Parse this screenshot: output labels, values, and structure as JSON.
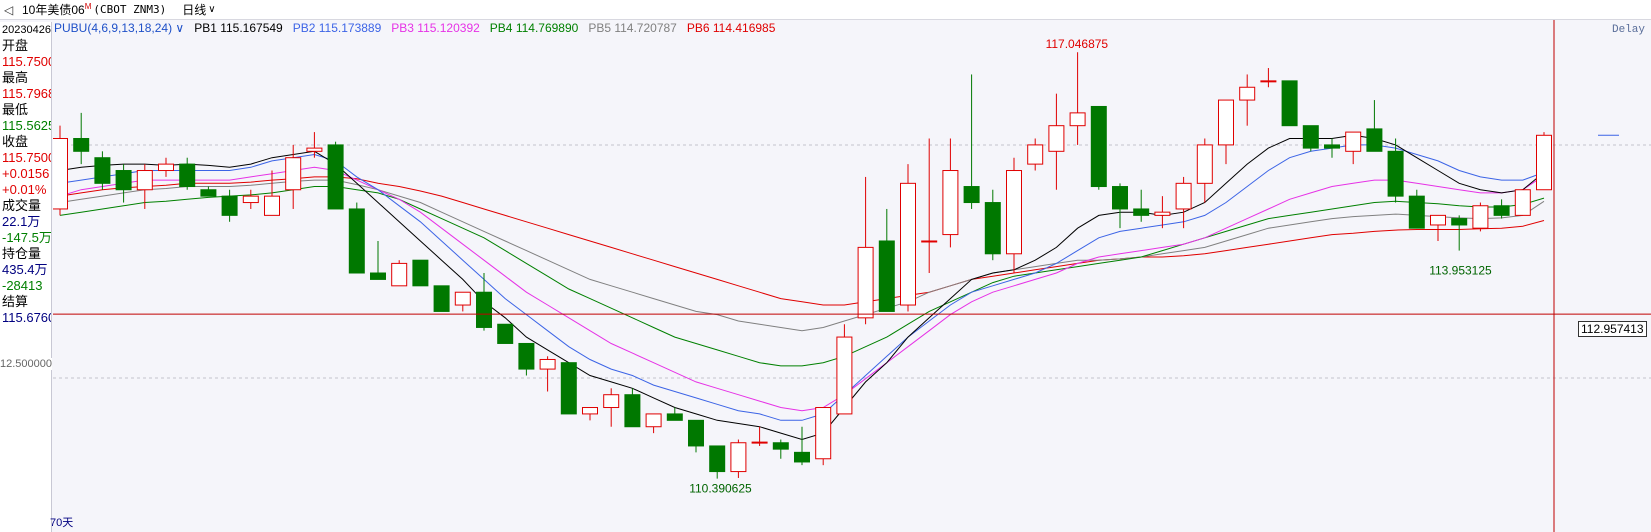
{
  "titlebar": {
    "instrument": "10年美债06",
    "instrument_sup": "M",
    "code": "(CBOT ZNM3)",
    "period": "日线",
    "back_icon": "back-icon",
    "dropdown_icon": "chevron-down-icon"
  },
  "info": {
    "date": "20230426",
    "open_label": "开盘",
    "open": "115.7500",
    "high_label": "最高",
    "high": "115.7968",
    "low_label": "最低",
    "low": "115.5625",
    "close_label": "收盘",
    "close": "115.7500",
    "change": "+0.0156",
    "change_pct": "+0.01%",
    "volume_label": "成交量",
    "volume": "22.1万",
    "volume_change": "-147.5万",
    "oi_label": "持仓量",
    "oi": "435.4万",
    "oi_change": "-28413",
    "settle_label": "结算",
    "settle": "115.6760"
  },
  "legend": {
    "pubu": "PUBU(4,6,9,13,18,24)",
    "pb1": "PB1 115.167549",
    "pb2": "PB2 115.173889",
    "pb3": "PB3 115.120392",
    "pb4": "PB4 114.769890",
    "pb5": "PB5 114.720787",
    "pb6": "PB6 114.416985"
  },
  "delay": "Delay",
  "period_label": "70天",
  "grid_level_label": "12.500000",
  "crosshair_price": "112.957413",
  "colors": {
    "up": "#e00000",
    "down": "#007800",
    "pb1": "#000000",
    "pb2": "#3c64e6",
    "pb3": "#e632e6",
    "pb4": "#008000",
    "pb5": "#808080",
    "pb6": "#e00000"
  },
  "chart_data": {
    "type": "candlestick",
    "ylim": [
      109.9,
      117.55
    ],
    "annotations": {
      "max": "117.046875",
      "min": "110.390625",
      "local_low": "113.953125"
    },
    "candles": [
      {
        "o": 114.6,
        "h": 115.9,
        "l": 114.5,
        "c": 115.7
      },
      {
        "o": 115.7,
        "h": 116.1,
        "l": 115.3,
        "c": 115.5
      },
      {
        "o": 115.4,
        "h": 115.5,
        "l": 114.9,
        "c": 115.0
      },
      {
        "o": 115.2,
        "h": 115.3,
        "l": 114.7,
        "c": 114.9
      },
      {
        "o": 114.9,
        "h": 115.3,
        "l": 114.6,
        "c": 115.2
      },
      {
        "o": 115.2,
        "h": 115.4,
        "l": 115.1,
        "c": 115.3
      },
      {
        "o": 115.3,
        "h": 115.4,
        "l": 114.9,
        "c": 114.95
      },
      {
        "o": 114.9,
        "h": 114.95,
        "l": 114.8,
        "c": 114.8
      },
      {
        "o": 114.8,
        "h": 114.9,
        "l": 114.4,
        "c": 114.5
      },
      {
        "o": 114.7,
        "h": 114.9,
        "l": 114.6,
        "c": 114.8
      },
      {
        "o": 114.5,
        "h": 115.2,
        "l": 114.5,
        "c": 114.8
      },
      {
        "o": 114.9,
        "h": 115.6,
        "l": 114.6,
        "c": 115.4
      },
      {
        "o": 115.5,
        "h": 115.8,
        "l": 115.4,
        "c": 115.55
      },
      {
        "o": 115.6,
        "h": 115.65,
        "l": 114.6,
        "c": 114.6
      },
      {
        "o": 114.6,
        "h": 114.7,
        "l": 113.6,
        "c": 113.6
      },
      {
        "o": 113.6,
        "h": 114.1,
        "l": 113.5,
        "c": 113.5
      },
      {
        "o": 113.4,
        "h": 113.8,
        "l": 113.4,
        "c": 113.75
      },
      {
        "o": 113.8,
        "h": 113.8,
        "l": 113.4,
        "c": 113.4
      },
      {
        "o": 113.4,
        "h": 113.4,
        "l": 113.0,
        "c": 113.0
      },
      {
        "o": 113.1,
        "h": 113.3,
        "l": 113.0,
        "c": 113.3
      },
      {
        "o": 113.3,
        "h": 113.6,
        "l": 112.7,
        "c": 112.75
      },
      {
        "o": 112.8,
        "h": 112.8,
        "l": 112.5,
        "c": 112.5
      },
      {
        "o": 112.5,
        "h": 112.5,
        "l": 112.0,
        "c": 112.1
      },
      {
        "o": 112.1,
        "h": 112.3,
        "l": 111.75,
        "c": 112.25
      },
      {
        "o": 112.2,
        "h": 112.2,
        "l": 111.4,
        "c": 111.4
      },
      {
        "o": 111.4,
        "h": 111.5,
        "l": 111.3,
        "c": 111.5
      },
      {
        "o": 111.5,
        "h": 111.8,
        "l": 111.2,
        "c": 111.7
      },
      {
        "o": 111.7,
        "h": 111.8,
        "l": 111.2,
        "c": 111.2
      },
      {
        "o": 111.2,
        "h": 111.4,
        "l": 111.1,
        "c": 111.4
      },
      {
        "o": 111.4,
        "h": 111.5,
        "l": 111.3,
        "c": 111.3
      },
      {
        "o": 111.3,
        "h": 111.3,
        "l": 110.8,
        "c": 110.9
      },
      {
        "o": 110.9,
        "h": 110.9,
        "l": 110.39,
        "c": 110.5
      },
      {
        "o": 110.5,
        "h": 111.0,
        "l": 110.4,
        "c": 110.95
      },
      {
        "o": 110.95,
        "h": 111.2,
        "l": 110.9,
        "c": 110.96
      },
      {
        "o": 110.95,
        "h": 111.0,
        "l": 110.7,
        "c": 110.85
      },
      {
        "o": 110.8,
        "h": 111.2,
        "l": 110.6,
        "c": 110.65
      },
      {
        "o": 110.7,
        "h": 111.5,
        "l": 110.6,
        "c": 111.5
      },
      {
        "o": 111.4,
        "h": 112.8,
        "l": 111.4,
        "c": 112.6
      },
      {
        "o": 112.9,
        "h": 115.1,
        "l": 112.8,
        "c": 114.0
      },
      {
        "o": 114.1,
        "h": 114.6,
        "l": 113.0,
        "c": 113.0
      },
      {
        "o": 113.1,
        "h": 115.3,
        "l": 113.0,
        "c": 115.0
      },
      {
        "o": 114.1,
        "h": 115.7,
        "l": 113.6,
        "c": 114.1
      },
      {
        "o": 114.2,
        "h": 115.7,
        "l": 114.0,
        "c": 115.2
      },
      {
        "o": 114.95,
        "h": 116.7,
        "l": 114.6,
        "c": 114.7
      },
      {
        "o": 114.7,
        "h": 114.9,
        "l": 113.8,
        "c": 113.9
      },
      {
        "o": 113.9,
        "h": 115.4,
        "l": 113.6,
        "c": 115.2
      },
      {
        "o": 115.3,
        "h": 115.7,
        "l": 115.2,
        "c": 115.6
      },
      {
        "o": 115.5,
        "h": 116.4,
        "l": 114.9,
        "c": 115.9
      },
      {
        "o": 115.9,
        "h": 117.046875,
        "l": 115.6,
        "c": 116.1
      },
      {
        "o": 116.2,
        "h": 116.2,
        "l": 114.9,
        "c": 114.95
      },
      {
        "o": 114.95,
        "h": 115.0,
        "l": 114.3,
        "c": 114.6
      },
      {
        "o": 114.6,
        "h": 114.9,
        "l": 114.4,
        "c": 114.5
      },
      {
        "o": 114.5,
        "h": 114.8,
        "l": 114.3,
        "c": 114.55
      },
      {
        "o": 114.6,
        "h": 115.1,
        "l": 114.3,
        "c": 115.0
      },
      {
        "o": 115.0,
        "h": 115.7,
        "l": 114.7,
        "c": 115.6
      },
      {
        "o": 115.6,
        "h": 116.3,
        "l": 115.3,
        "c": 116.3
      },
      {
        "o": 116.3,
        "h": 116.7,
        "l": 115.9,
        "c": 116.5
      },
      {
        "o": 116.6,
        "h": 116.8,
        "l": 116.5,
        "c": 116.6
      },
      {
        "o": 116.6,
        "h": 116.6,
        "l": 115.9,
        "c": 115.9
      },
      {
        "o": 115.9,
        "h": 115.9,
        "l": 115.5,
        "c": 115.55
      },
      {
        "o": 115.6,
        "h": 115.7,
        "l": 115.4,
        "c": 115.55
      },
      {
        "o": 115.5,
        "h": 115.8,
        "l": 115.3,
        "c": 115.8
      },
      {
        "o": 115.85,
        "h": 116.3,
        "l": 115.6,
        "c": 115.5
      },
      {
        "o": 115.5,
        "h": 115.7,
        "l": 114.7,
        "c": 114.8
      },
      {
        "o": 114.8,
        "h": 114.9,
        "l": 114.3,
        "c": 114.3
      },
      {
        "o": 114.35,
        "h": 114.4,
        "l": 114.1,
        "c": 114.5
      },
      {
        "o": 114.45,
        "h": 114.5,
        "l": 113.95,
        "c": 114.35
      },
      {
        "o": 114.3,
        "h": 114.7,
        "l": 114.25,
        "c": 114.65
      },
      {
        "o": 114.65,
        "h": 114.75,
        "l": 114.45,
        "c": 114.5
      },
      {
        "o": 114.5,
        "h": 114.9,
        "l": 114.5,
        "c": 114.9
      },
      {
        "o": 114.9,
        "h": 115.8,
        "l": 114.9,
        "c": 115.75
      }
    ],
    "series": [
      {
        "name": "PB1",
        "values": [
          115.2,
          115.25,
          115.28,
          115.3,
          115.3,
          115.28,
          115.3,
          115.28,
          115.25,
          115.3,
          115.4,
          115.45,
          115.5,
          115.3,
          115.0,
          114.7,
          114.4,
          114.1,
          113.8,
          113.5,
          113.15,
          112.9,
          112.6,
          112.4,
          112.2,
          112.0,
          111.9,
          111.8,
          111.65,
          111.5,
          111.4,
          111.3,
          111.25,
          111.2,
          111.1,
          111.0,
          111.1,
          111.5,
          111.9,
          112.2,
          112.6,
          112.9,
          113.2,
          113.5,
          113.6,
          113.65,
          113.8,
          114.0,
          114.3,
          114.5,
          114.55,
          114.55,
          114.5,
          114.55,
          114.7,
          115.0,
          115.3,
          115.55,
          115.7,
          115.7,
          115.7,
          115.75,
          115.7,
          115.6,
          115.4,
          115.2,
          115.0,
          114.9,
          114.85,
          114.9,
          115.17
        ]
      },
      {
        "name": "PB2",
        "values": [
          115.0,
          115.05,
          115.1,
          115.15,
          115.2,
          115.2,
          115.2,
          115.2,
          115.2,
          115.25,
          115.35,
          115.4,
          115.45,
          115.35,
          115.1,
          114.9,
          114.65,
          114.4,
          114.1,
          113.8,
          113.5,
          113.2,
          112.95,
          112.7,
          112.45,
          112.25,
          112.1,
          112.0,
          111.85,
          111.75,
          111.65,
          111.55,
          111.45,
          111.4,
          111.3,
          111.3,
          111.4,
          111.7,
          112.0,
          112.3,
          112.6,
          112.85,
          113.1,
          113.3,
          113.4,
          113.5,
          113.6,
          113.75,
          113.95,
          114.15,
          114.25,
          114.3,
          114.35,
          114.4,
          114.5,
          114.7,
          114.95,
          115.2,
          115.4,
          115.5,
          115.55,
          115.6,
          115.6,
          115.55,
          115.45,
          115.35,
          115.2,
          115.1,
          115.05,
          115.05,
          115.17
        ]
      },
      {
        "name": "PB3",
        "values": [
          114.8,
          114.9,
          114.95,
          115.0,
          115.05,
          115.05,
          115.05,
          115.05,
          115.05,
          115.1,
          115.15,
          115.2,
          115.25,
          115.2,
          115.05,
          114.9,
          114.75,
          114.55,
          114.3,
          114.05,
          113.8,
          113.55,
          113.3,
          113.1,
          112.9,
          112.7,
          112.5,
          112.35,
          112.2,
          112.05,
          111.9,
          111.8,
          111.7,
          111.6,
          111.5,
          111.45,
          111.5,
          111.7,
          111.95,
          112.2,
          112.45,
          112.7,
          112.95,
          113.15,
          113.3,
          113.4,
          113.5,
          113.6,
          113.75,
          113.85,
          113.9,
          113.95,
          114.0,
          114.05,
          114.15,
          114.3,
          114.45,
          114.6,
          114.75,
          114.85,
          114.95,
          115.0,
          115.05,
          115.05,
          115.0,
          114.95,
          114.9,
          114.85,
          114.85,
          114.9,
          115.12
        ]
      },
      {
        "name": "PB4",
        "values": [
          114.5,
          114.55,
          114.6,
          114.65,
          114.7,
          114.72,
          114.75,
          114.78,
          114.8,
          114.82,
          114.85,
          114.9,
          114.95,
          114.95,
          114.9,
          114.85,
          114.75,
          114.6,
          114.45,
          114.3,
          114.15,
          113.95,
          113.75,
          113.55,
          113.35,
          113.2,
          113.05,
          112.9,
          112.75,
          112.6,
          112.5,
          112.4,
          112.3,
          112.2,
          112.15,
          112.15,
          112.2,
          112.3,
          112.45,
          112.6,
          112.8,
          113.0,
          113.15,
          113.3,
          113.45,
          113.55,
          113.6,
          113.65,
          113.7,
          113.75,
          113.8,
          113.85,
          113.95,
          114.05,
          114.15,
          114.25,
          114.35,
          114.45,
          114.5,
          114.55,
          114.6,
          114.65,
          114.7,
          114.72,
          114.7,
          114.68,
          114.65,
          114.63,
          114.63,
          114.67,
          114.77
        ]
      },
      {
        "name": "PB5",
        "values": [
          114.7,
          114.75,
          114.8,
          114.85,
          114.9,
          114.92,
          114.95,
          114.95,
          114.95,
          114.97,
          115.0,
          115.03,
          115.05,
          115.05,
          114.98,
          114.9,
          114.8,
          114.7,
          114.55,
          114.4,
          114.25,
          114.1,
          113.95,
          113.8,
          113.65,
          113.5,
          113.4,
          113.3,
          113.2,
          113.1,
          113.0,
          112.95,
          112.85,
          112.8,
          112.75,
          112.7,
          112.75,
          112.85,
          112.95,
          113.05,
          113.15,
          113.3,
          113.4,
          113.5,
          113.6,
          113.65,
          113.7,
          113.75,
          113.8,
          113.8,
          113.82,
          113.85,
          113.9,
          113.95,
          114.0,
          114.1,
          114.2,
          114.3,
          114.35,
          114.4,
          114.45,
          114.48,
          114.5,
          114.52,
          114.5,
          114.48,
          114.46,
          114.45,
          114.46,
          114.5,
          114.72
        ]
      },
      {
        "name": "PB6",
        "values": [
          114.8,
          114.85,
          114.9,
          114.93,
          114.95,
          114.97,
          115.0,
          115.0,
          115.0,
          115.02,
          115.05,
          115.07,
          115.1,
          115.1,
          115.07,
          115.0,
          114.95,
          114.88,
          114.8,
          114.7,
          114.6,
          114.5,
          114.4,
          114.3,
          114.2,
          114.1,
          114.0,
          113.9,
          113.8,
          113.7,
          113.6,
          113.5,
          113.4,
          113.3,
          113.2,
          113.15,
          113.1,
          113.1,
          113.15,
          113.2,
          113.25,
          113.3,
          113.4,
          113.5,
          113.55,
          113.6,
          113.65,
          113.7,
          113.75,
          113.8,
          113.82,
          113.85,
          113.85,
          113.87,
          113.9,
          113.95,
          114.0,
          114.05,
          114.1,
          114.15,
          114.2,
          114.22,
          114.25,
          114.27,
          114.28,
          114.28,
          114.28,
          114.29,
          114.3,
          114.33,
          114.42
        ]
      }
    ]
  }
}
